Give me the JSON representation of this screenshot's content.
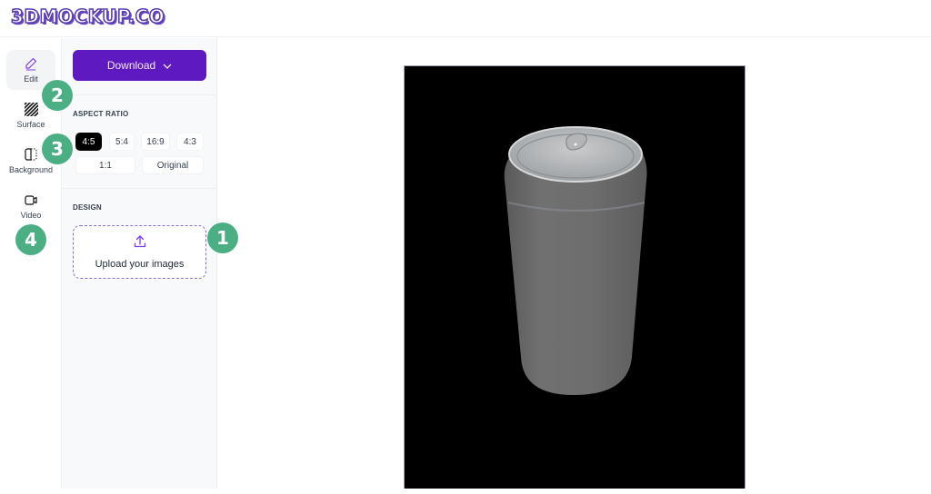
{
  "header": {
    "logo": "3DMOCKUP.CO"
  },
  "rail": {
    "items": [
      {
        "label": "Edit",
        "icon": "pencil-icon",
        "active": true
      },
      {
        "label": "Surface",
        "icon": "hatch-texture-icon",
        "active": false
      },
      {
        "label": "Background",
        "icon": "split-square-icon",
        "active": false
      },
      {
        "label": "Video",
        "icon": "video-camera-icon",
        "active": false
      }
    ]
  },
  "panel": {
    "download_label": "Download",
    "aspect_ratio": {
      "title": "ASPECT RATIO",
      "options": [
        "4:5",
        "5:4",
        "16:9",
        "4:3",
        "1:1",
        "Original"
      ],
      "selected": "4:5"
    },
    "design": {
      "title": "DESIGN",
      "upload_label": "Upload your images"
    }
  },
  "annotations": [
    "1",
    "2",
    "3",
    "4"
  ],
  "colors": {
    "brand_purple": "#5f19c1",
    "badge_green": "#4caf84",
    "viewport_bg": "#000000",
    "can_gray": "#6b6b6b"
  },
  "viewport": {
    "model": "aluminum-can",
    "aspect_ratio": "4:5"
  }
}
